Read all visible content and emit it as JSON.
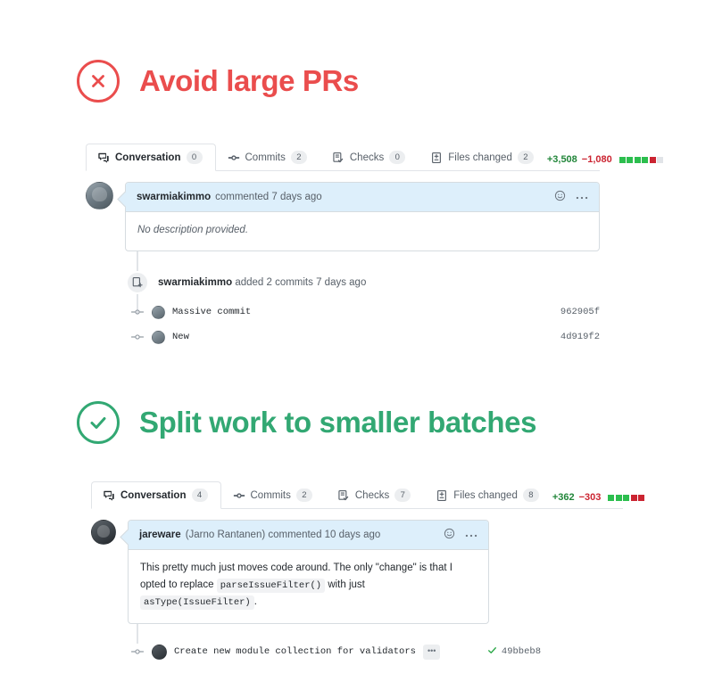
{
  "sections": [
    {
      "id": "avoid-large-prs",
      "icon": "x-circle-icon",
      "tone": "bad",
      "color": "#ea4d4d",
      "title": "Avoid large PRs"
    },
    {
      "id": "split-work",
      "icon": "check-circle-icon",
      "tone": "good",
      "color": "#32a873",
      "title": "Split work to smaller batches"
    }
  ],
  "pr_bad": {
    "tabs": [
      {
        "label": "Conversation",
        "count": "0",
        "icon": "comment-discussion-icon",
        "active": true
      },
      {
        "label": "Commits",
        "count": "2",
        "icon": "git-commit-icon",
        "active": false
      },
      {
        "label": "Checks",
        "count": "0",
        "icon": "checklist-icon",
        "active": false
      },
      {
        "label": "Files changed",
        "count": "2",
        "icon": "file-diff-icon",
        "active": false
      }
    ],
    "diffstat": {
      "additions": "+3,508",
      "deletions": "−1,080",
      "blocks": [
        "g",
        "g",
        "g",
        "g",
        "r",
        "n"
      ]
    },
    "comment": {
      "author": "swarmiakimmo",
      "meta": "commented 7 days ago",
      "body": "No description provided.",
      "reaction_icon": "smiley-icon",
      "menu_icon": "kebab-horizontal-icon"
    },
    "event": {
      "icon": "repo-push-icon",
      "author": "swarmiakimmo",
      "text": "added 2 commits 7 days ago"
    },
    "commits": [
      {
        "message": "Massive commit",
        "hash": "962905f"
      },
      {
        "message": "New",
        "hash": "4d919f2"
      }
    ]
  },
  "pr_good": {
    "tabs": [
      {
        "label": "Conversation",
        "count": "4",
        "icon": "comment-discussion-icon",
        "active": true
      },
      {
        "label": "Commits",
        "count": "2",
        "icon": "git-commit-icon",
        "active": false
      },
      {
        "label": "Checks",
        "count": "7",
        "icon": "checklist-icon",
        "active": false
      },
      {
        "label": "Files changed",
        "count": "8",
        "icon": "file-diff-icon",
        "active": false
      }
    ],
    "diffstat": {
      "additions": "+362",
      "deletions": "−303",
      "blocks": [
        "g",
        "g",
        "g",
        "r",
        "r"
      ]
    },
    "comment": {
      "author": "jareware",
      "meta": "(Jarno Rantanen) commented 10 days ago",
      "body_part1": "This pretty much just moves code around. The only \"change\" is that I opted to replace",
      "code1": "parseIssueFilter()",
      "body_part2": "with just",
      "code2": "asType(IssueFilter)",
      "body_part3": ".",
      "reaction_icon": "smiley-icon",
      "menu_icon": "kebab-horizontal-icon"
    },
    "commits": [
      {
        "message": "Create new module collection for validators",
        "more_label": "•••",
        "status_icon": "check-icon",
        "hash": "49bbeb8"
      }
    ]
  }
}
